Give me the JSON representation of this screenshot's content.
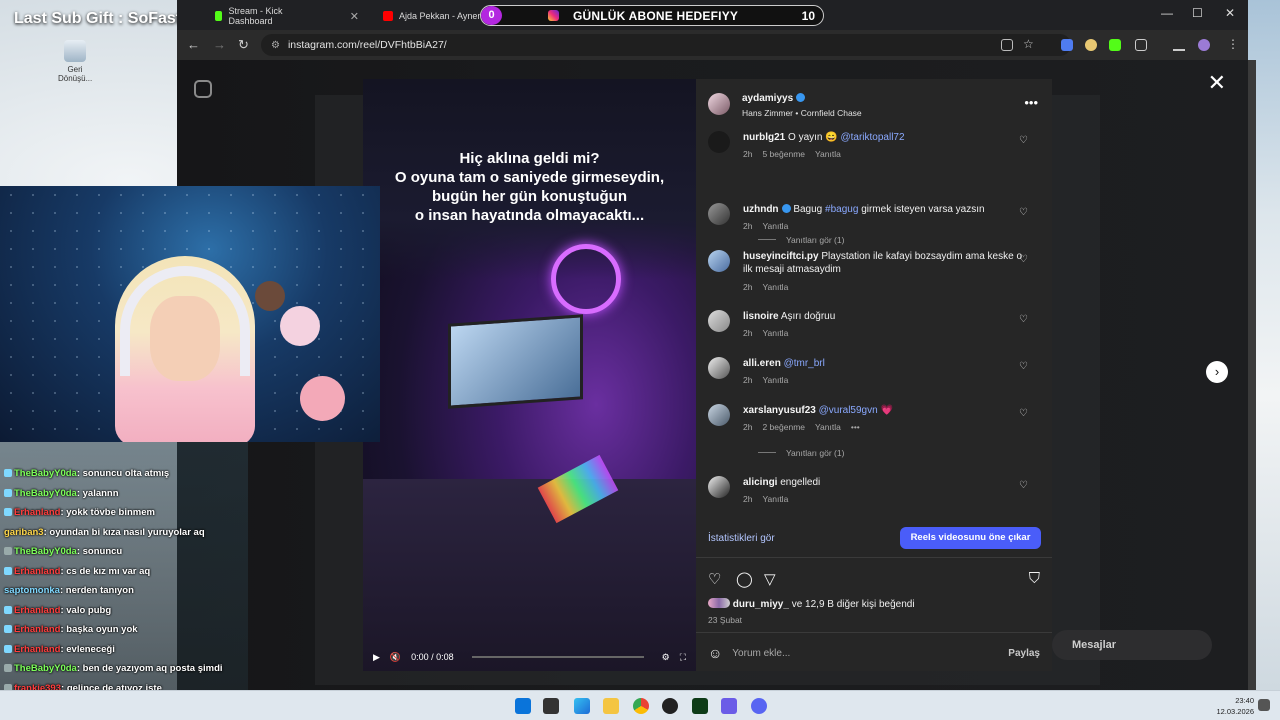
{
  "desktop": {
    "overlay_title": "Last Sub Gift : SoFastAim",
    "recycle_label": "Geri Dönüşü..."
  },
  "goal_bar": {
    "current": "0",
    "label": "GÜNLÜK ABONE HEDEFIYY",
    "target": "10"
  },
  "browser": {
    "tabs": [
      {
        "title": "Stream - Kick Dashboard",
        "favicon_color": "#53fc18"
      },
      {
        "title": "Ajda Pekkan - Aynen Öy",
        "favicon_color": "#ff0000"
      }
    ],
    "url": "instagram.com/reel/DVFhtbBiA27/"
  },
  "post": {
    "author": "aydamiyys",
    "audio": "Hans Zimmer • Cornfield Chase",
    "video_caption": [
      "Hiç aklına geldi mi?",
      "O oyuna tam o saniyede girmeseydin,",
      "bugün her gün konuştuğun",
      "o insan hayatında olmayacaktı..."
    ],
    "video_time": "0:00 / 0:08"
  },
  "comments": [
    {
      "user": "nurblg21",
      "text": "O yayın 😄",
      "mention": "@tariktopall72",
      "time": "2h",
      "likes": "5 beğenme",
      "reply": "Yanıtla",
      "replies": "Yanıtları gör (1)"
    },
    {
      "user": "uzhndn",
      "verified": true,
      "text": "Bagug",
      "mention": "#bagug",
      "text2": "girmek isteyen varsa yazsın",
      "time": "2h",
      "reply": "Yanıtla"
    },
    {
      "user": "huseyinciftci.py",
      "text": "Playstation ile kafayi bozsaydim ama keske o ilk mesaji atmasaydim",
      "time": "2h",
      "reply": "Yanıtla"
    },
    {
      "user": "lisnoire",
      "text": "Aşırı doğruu",
      "time": "2h",
      "reply": "Yanıtla"
    },
    {
      "user": "alli.eren",
      "mention": "@tmr_brl",
      "time": "2h",
      "reply": "Yanıtla"
    },
    {
      "user": "xarslanyusuf23",
      "mention": "@vural59gvn",
      "text": "💗",
      "time": "2h",
      "likes": "2 beğenme",
      "reply": "Yanıtla",
      "more": "•••",
      "replies": "Yanıtları gör (1)"
    },
    {
      "user": "alicingi",
      "text": "engelledi",
      "time": "2h",
      "reply": "Yanıtla"
    }
  ],
  "actions": {
    "insights": "İstatistikleri gör",
    "boost": "Reels videosunu öne çıkar",
    "liked_by_user": "duru_miyy_",
    "liked_by_rest": "ve 12,9 B diğer kişi beğendi",
    "date": "23 Şubat",
    "comment_placeholder": "Yorum ekle...",
    "post_button": "Paylaş",
    "messages": "Mesajlar"
  },
  "chat": [
    {
      "user": "TheBabyY0da",
      "color": "green",
      "msg": "sonuncu olta atmış"
    },
    {
      "user": "TheBabyY0da",
      "color": "green",
      "msg": "yalannn"
    },
    {
      "user": "Erhanland",
      "color": "red",
      "msg": "yokk tövbe binmem"
    },
    {
      "user": "gariban3",
      "color": "yellow",
      "msg": "oyundan bi kıza nasıl yuruyolar aq"
    },
    {
      "user": "TheBabyY0da",
      "color": "green",
      "msg": "sonuncu"
    },
    {
      "user": "Erhanland",
      "color": "red",
      "msg": "cs de kız mı var aq"
    },
    {
      "user": "saptomonka",
      "color": "cyan",
      "msg": "nerden tanıyon"
    },
    {
      "user": "Erhanland",
      "color": "red",
      "msg": "valo pubg"
    },
    {
      "user": "Erhanland",
      "color": "red",
      "msg": "başka oyun yok"
    },
    {
      "user": "Erhanland",
      "color": "red",
      "msg": "evleneceği"
    },
    {
      "user": "TheBabyY0da",
      "color": "green",
      "msg": "ben de yazıyom aq posta şimdi"
    },
    {
      "user": "frankie393",
      "color": "red",
      "msg": "gelince de atıyoz işte"
    }
  ],
  "taskbar": {
    "time": "23:40",
    "date": "12.03.2026"
  },
  "colors": {
    "accent": "#4a5df9",
    "kick_green": "#53fc18",
    "goal_purple": "#b327e0"
  }
}
